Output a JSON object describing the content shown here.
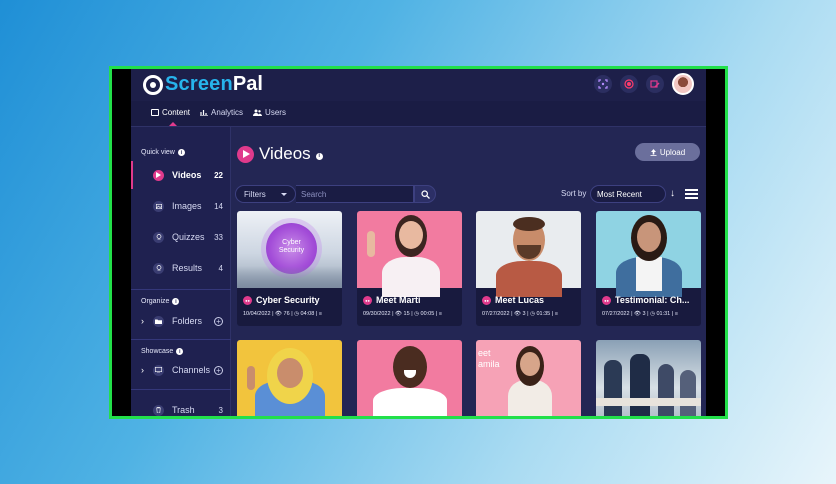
{
  "app": {
    "brand_screen": "Screen",
    "brand_pal": "Pal"
  },
  "nav": {
    "tabs": [
      {
        "label": "Content",
        "active": true
      },
      {
        "label": "Analytics",
        "active": false
      },
      {
        "label": "Users",
        "active": false
      }
    ]
  },
  "sidebar": {
    "quick_view_label": "Quick view",
    "items": [
      {
        "label": "Videos",
        "count": "22",
        "active": true
      },
      {
        "label": "Images",
        "count": "14"
      },
      {
        "label": "Quizzes",
        "count": "33"
      },
      {
        "label": "Results",
        "count": "4"
      }
    ],
    "organize_label": "Organize",
    "folders_label": "Folders",
    "showcase_label": "Showcase",
    "channels_label": "Channels",
    "trash_label": "Trash",
    "trash_count": "3"
  },
  "main": {
    "title": "Videos",
    "upload_label": "Upload",
    "filters_label": "Filters",
    "search_placeholder": "Search",
    "sort_by_label": "Sort by",
    "sort_value": "Most Recent"
  },
  "cards": [
    {
      "title": "Cyber Security",
      "date": "10/04/2022",
      "views": "76",
      "duration": "04:08",
      "thumb_text": "Cyber\nSecurity"
    },
    {
      "title": "Meet Marti",
      "date": "09/30/2022",
      "views": "15",
      "duration": "00:05"
    },
    {
      "title": "Meet Lucas",
      "date": "07/27/2022",
      "views": "3",
      "duration": "01:35"
    },
    {
      "title": "Testimonial: Ch...",
      "date": "07/27/2022",
      "views": "3",
      "duration": "01:31"
    }
  ],
  "thumb_overlay_text": "eet\namila",
  "colors": {
    "accent": "#e03a8c",
    "background": "#232654",
    "brand_blue": "#27b4ec",
    "frame_border": "#22e04a"
  }
}
